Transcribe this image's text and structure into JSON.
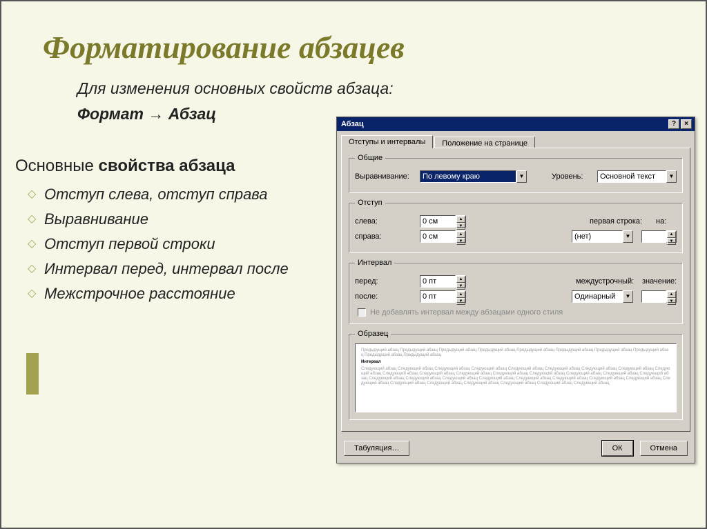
{
  "slide": {
    "title": "Форматирование абзацев",
    "subtitle_line1": "Для изменения основных свойств абзаца:",
    "subtitle_line2_a": "Формат",
    "subtitle_line2_arrow": "→",
    "subtitle_line2_b": "Абзац",
    "properties_head_a": "Основные ",
    "properties_head_b": "свойства абзаца",
    "bullets": [
      "Отступ слева, отступ справа",
      "Выравнивание",
      "Отступ первой строки",
      "Интервал перед, интервал после",
      "Межстрочное расстояние"
    ]
  },
  "dialog": {
    "title": "Абзац",
    "help": "?",
    "close": "×",
    "tabs": {
      "t1": "Отступы и интервалы",
      "t2": "Положение на странице"
    },
    "g_general": {
      "legend": "Общие",
      "align_lbl": "Выравнивание:",
      "align_val": "По левому краю",
      "level_lbl": "Уровень:",
      "level_val": "Основной текст"
    },
    "g_indent": {
      "legend": "Отступ",
      "left_lbl": "слева:",
      "left_val": "0 см",
      "right_lbl": "справа:",
      "right_val": "0 см",
      "first_lbl": "первая строка:",
      "first_val": "(нет)",
      "on_lbl": "на:",
      "on_val": ""
    },
    "g_spacing": {
      "legend": "Интервал",
      "before_lbl": "перед:",
      "before_val": "0 пт",
      "after_lbl": "после:",
      "after_val": "0 пт",
      "line_lbl": "междустрочный:",
      "line_val": "Одинарный",
      "val_lbl": "значение:",
      "val_val": "",
      "chk_lbl": "Не добавлять интервал между абзацами одного стиля"
    },
    "g_preview": {
      "legend": "Образец"
    },
    "buttons": {
      "tab": "Табуляция…",
      "ok": "ОК",
      "cancel": "Отмена"
    }
  }
}
